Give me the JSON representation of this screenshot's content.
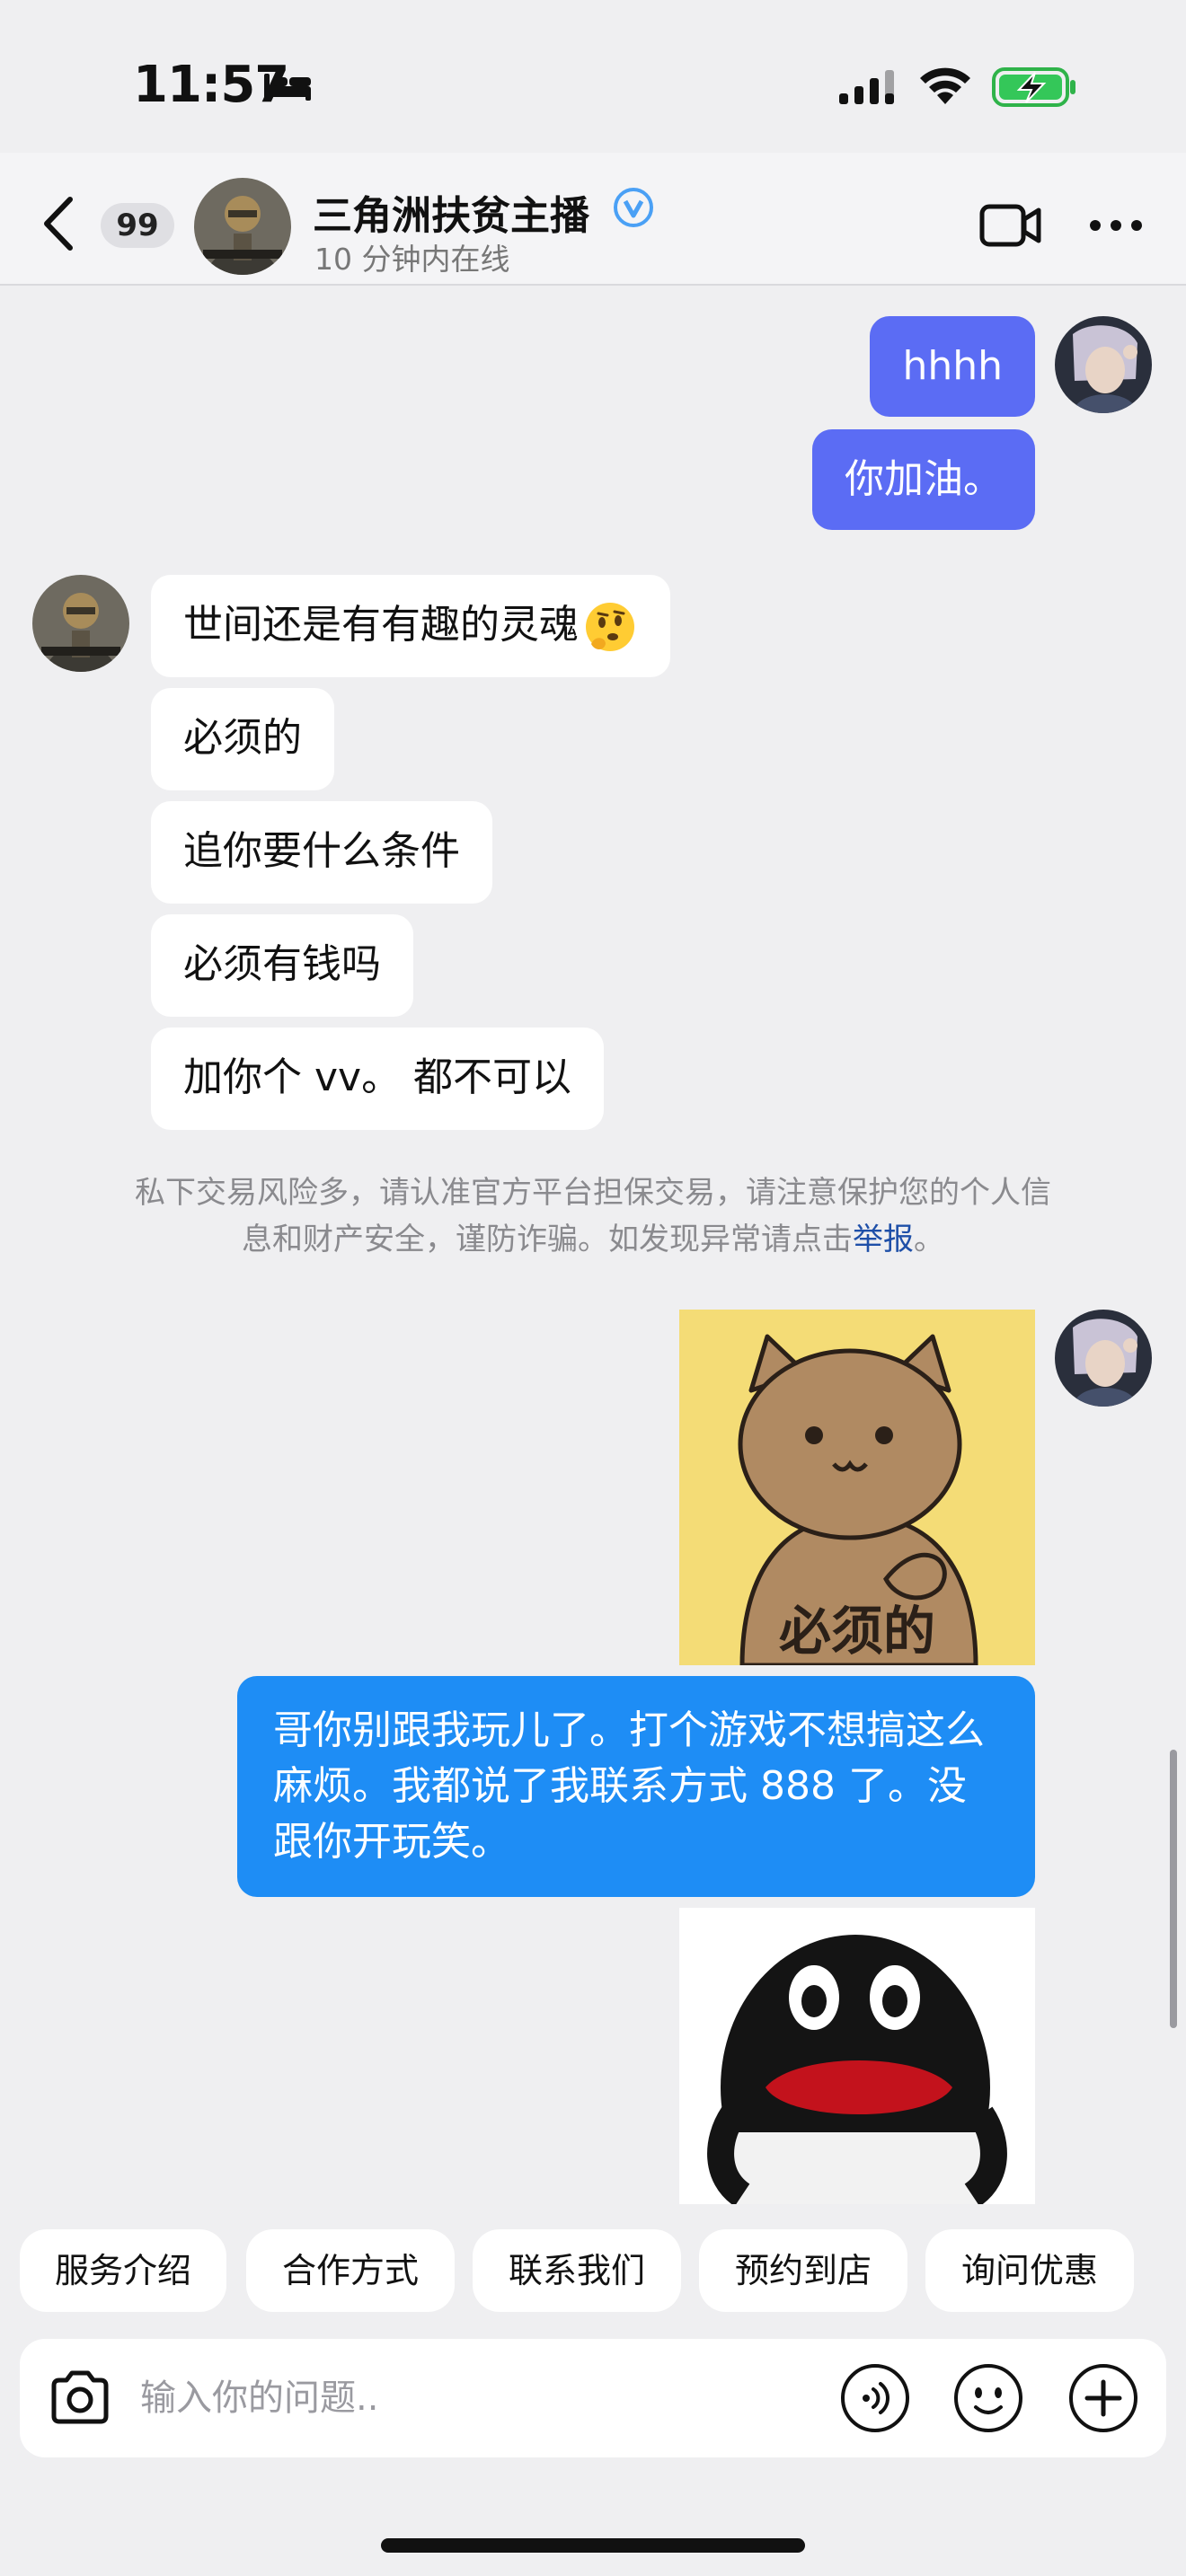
{
  "status_bar": {
    "time": "11:57"
  },
  "header": {
    "back_label": "back",
    "unread_count": "99",
    "name": "三角洲扶贫主播",
    "status": "10 分钟内在线"
  },
  "messages": [
    {
      "side": "out",
      "text": "hhhh"
    },
    {
      "side": "out",
      "text": "你加油。"
    },
    {
      "side": "in",
      "text": "世间还是有有趣的灵魂",
      "emoji": "thinking-face"
    },
    {
      "side": "in",
      "text": "必须的"
    },
    {
      "side": "in",
      "text": "追你要什么条件"
    },
    {
      "side": "in",
      "text": "必须有钱吗"
    },
    {
      "side": "in",
      "text": "加你个 vv。 都不可以"
    },
    {
      "side": "out",
      "sticker": "cat-sticker",
      "caption": "必须的"
    },
    {
      "side": "out",
      "text": "哥你别跟我玩儿了。打个游戏不想搞这么麻烦。我都说了我联系方式 888 了。没跟你开玩笑。"
    },
    {
      "side": "out",
      "sticker": "penguin-sticker"
    }
  ],
  "notice": {
    "text": "私下交易风险多，请认准官方平台担保交易，请注意保护您的个人信息和财产安全，谨防诈骗。如发现异常请点击",
    "link": "举报",
    "suffix": "。"
  },
  "quick_replies": [
    "服务介绍",
    "合作方式",
    "联系我们",
    "预约到店",
    "询问优惠"
  ],
  "input": {
    "placeholder": "输入你的问题.."
  },
  "colors": {
    "out_bubble": "#5b6cf4",
    "out_bubble_active": "#1e8df5",
    "in_bubble": "#ffffff",
    "background": "#efeff1",
    "link": "#1e4fa8"
  }
}
